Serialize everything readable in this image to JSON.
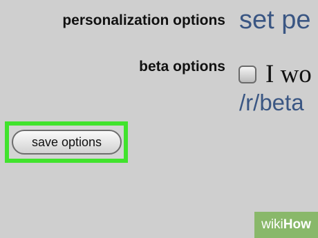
{
  "preferences": {
    "personalization_label": "personalization options",
    "personalization_link": "set pe",
    "beta_label": "beta options",
    "beta_checkbox_checked": false,
    "beta_checkbox_text": "I wo",
    "beta_link": "/r/beta",
    "save_button_label": "save options"
  },
  "highlight_color": "#41e32d",
  "watermark": {
    "part1": "wiki",
    "part2": "How"
  }
}
